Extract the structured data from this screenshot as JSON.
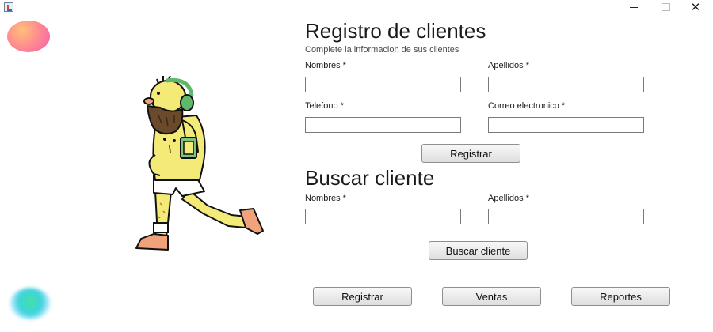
{
  "window": {
    "minimize_icon": "minimize-icon",
    "maximize_icon": "maximize-icon",
    "close_glyph": "✕"
  },
  "registro": {
    "title": "Registro de clientes",
    "subtitle": "Complete la informacion de sus clientes",
    "nombres_label": "Nombres *",
    "nombres_value": "",
    "apellidos_label": "Apellidos *",
    "apellidos_value": "",
    "telefono_label": "Telefono *",
    "telefono_value": "",
    "correo_label": "Correo electronico *",
    "correo_value": "",
    "submit_label": "Registrar"
  },
  "buscar": {
    "title": "Buscar cliente",
    "nombres_label": "Nombres *",
    "nombres_value": "",
    "apellidos_label": "Apellidos *",
    "apellidos_value": "",
    "submit_label": "Buscar cliente"
  },
  "nav": {
    "registrar_label": "Registrar",
    "ventas_label": "Ventas",
    "reportes_label": "Reportes"
  },
  "colors": {
    "blob_top": "#f25db2",
    "blob_bottom": "#3fd2e0",
    "character_skin": "#f4ea78",
    "character_beard": "#6b4a2b",
    "headphones": "#5fb86a",
    "shoes": "#f0a37a"
  }
}
